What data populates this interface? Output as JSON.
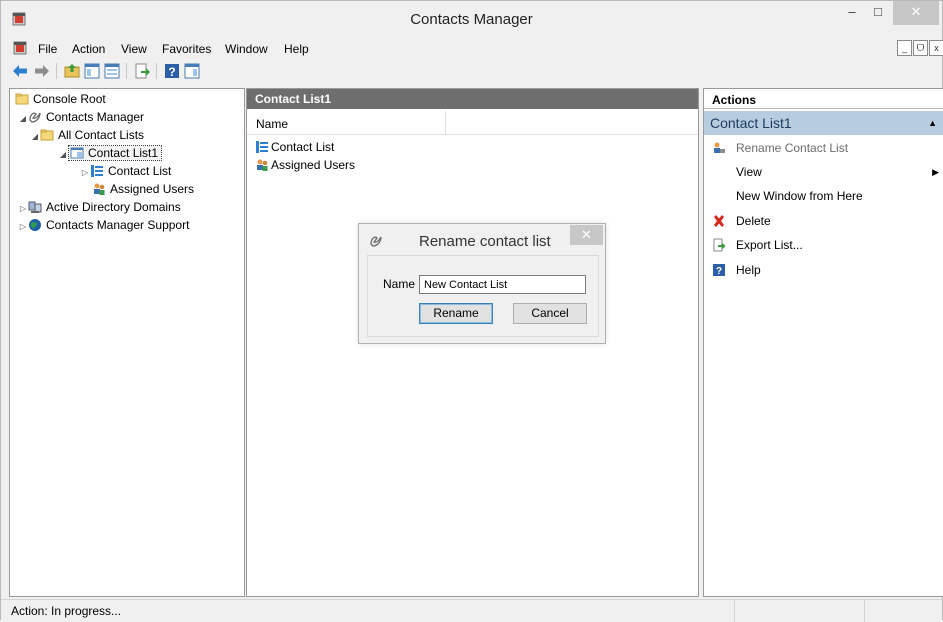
{
  "window": {
    "title": "Contacts Manager",
    "controls": {
      "minimize": "–",
      "maximize": "□",
      "close": "✕"
    }
  },
  "menu": {
    "items": [
      "File",
      "Action",
      "View",
      "Favorites",
      "Window",
      "Help"
    ]
  },
  "mdi_controls": {
    "minimize": "_",
    "restore": "ᗜ",
    "close": "x"
  },
  "tree": {
    "items": [
      {
        "label": "Console Root",
        "icon": "folder-icon"
      },
      {
        "label": "Contacts Manager",
        "icon": "contacts-manager-icon",
        "expanded": true
      },
      {
        "label": "All Contact Lists",
        "icon": "folder-icon",
        "expanded": true
      },
      {
        "label": "Contact List1",
        "icon": "contact-list-icon",
        "expanded": true,
        "selected": true
      },
      {
        "label": "Contact List",
        "icon": "list-icon",
        "expanded": false
      },
      {
        "label": "Assigned Users",
        "icon": "users-icon"
      },
      {
        "label": "Active Directory Domains",
        "icon": "directory-icon",
        "expanded": false
      },
      {
        "label": "Contacts Manager Support",
        "icon": "globe-icon",
        "expanded": false
      }
    ]
  },
  "list": {
    "header": "Contact List1",
    "column": "Name",
    "rows": [
      {
        "label": "Contact List",
        "icon": "list-icon"
      },
      {
        "label": "Assigned Users",
        "icon": "users-icon"
      }
    ]
  },
  "actions": {
    "header": "Actions",
    "section": "Contact List1",
    "items": [
      {
        "label": "Rename Contact List",
        "icon": "rename-icon",
        "disabled": true
      },
      {
        "label": "View",
        "submenu": true
      },
      {
        "label": "New Window from Here"
      },
      {
        "label": "Delete",
        "icon": "delete-icon"
      },
      {
        "label": "Export List...",
        "icon": "export-icon"
      },
      {
        "label": "Help",
        "icon": "help-icon"
      }
    ]
  },
  "status": {
    "text": "Action: In progress..."
  },
  "dialog": {
    "title": "Rename contact list",
    "close": "✕",
    "name_label": "Name",
    "name_value": "New Contact List",
    "rename_label": "Rename",
    "cancel_label": "Cancel"
  },
  "colors": {
    "actions_section_bg": "#b8cce0",
    "list_header_bg": "#6e6e6e",
    "close_button_bg": "#c7c7c7"
  }
}
